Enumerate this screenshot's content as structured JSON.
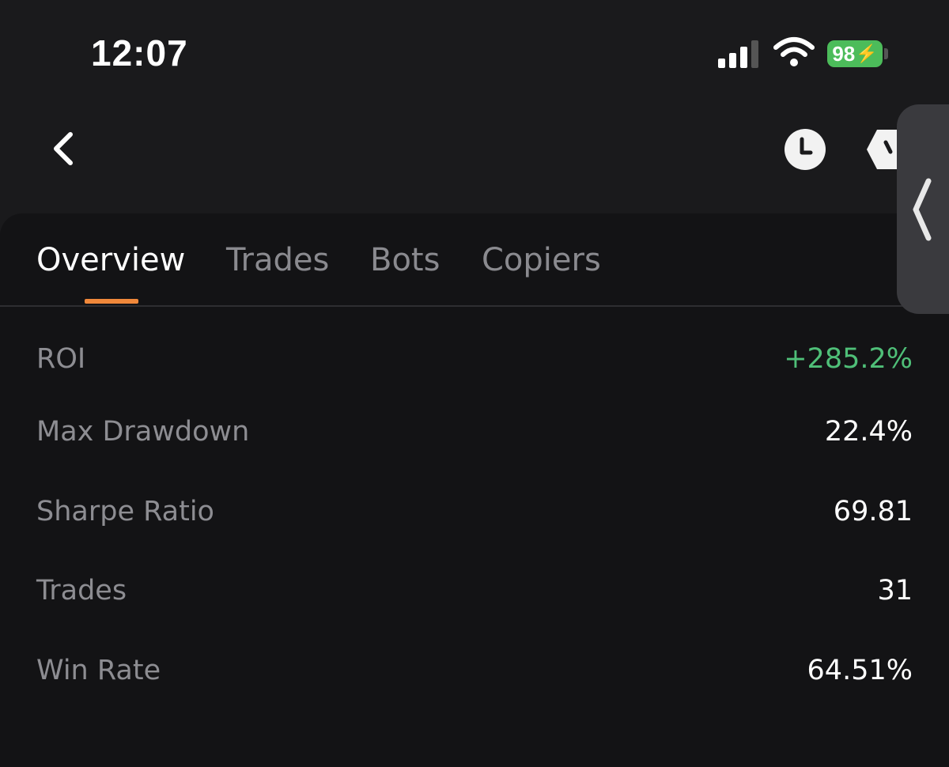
{
  "status_bar": {
    "time": "12:07",
    "battery_percent": "98",
    "battery_color": "#4cbc5a",
    "signal_icon": "cellular-signal-icon",
    "wifi_icon": "wifi-icon"
  },
  "header": {
    "back_icon": "chevron-left-icon",
    "history_icon": "clock-icon",
    "extra_icon": "hexagon-icon"
  },
  "tabs": [
    {
      "label": "Overview",
      "active": true
    },
    {
      "label": "Trades",
      "active": false
    },
    {
      "label": "Bots",
      "active": false
    },
    {
      "label": "Copiers",
      "active": false
    }
  ],
  "accent_color": "#f0883a",
  "positive_color": "#4fbf78",
  "stats": [
    {
      "label": "ROI",
      "value": "+285.2%"
    },
    {
      "label": "Max Drawdown",
      "value": "22.4%"
    },
    {
      "label": "Sharpe Ratio",
      "value": "69.81"
    },
    {
      "label": "Trades",
      "value": "31"
    },
    {
      "label": "Win Rate",
      "value": "64.51%"
    }
  ]
}
